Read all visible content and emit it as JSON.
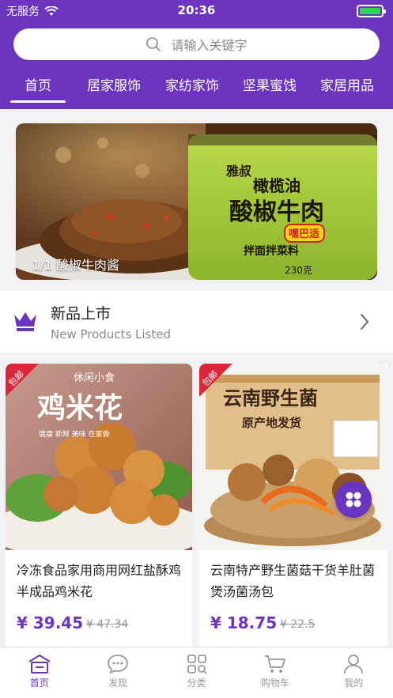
{
  "status_bar": {
    "carrier": "无服务",
    "time": "20:36"
  },
  "search": {
    "placeholder": "请输入关键字"
  },
  "tabs": [
    {
      "label": "首页",
      "active": true
    },
    {
      "label": "居家服饰"
    },
    {
      "label": "家纺家饰"
    },
    {
      "label": "坚果蜜饯"
    },
    {
      "label": "家居用品"
    }
  ],
  "banner": {
    "caption": "1/1 酸椒牛肉酱",
    "label_brand": "雅叔",
    "label_line1": "橄榄油",
    "label_line2": "酸椒牛肉",
    "label_badge": "嘿巴适",
    "label_line3": "拌面拌菜料",
    "label_weight": "230克"
  },
  "section": {
    "title": "新品上市",
    "subtitle": "New Products Listed"
  },
  "products": [
    {
      "name": "冷冻食品家用商用网红盐酥鸡半成品鸡米花",
      "price": "¥ 39.45",
      "old_price": "¥ 47.34",
      "ribbon": "包邮",
      "image_text_big": "鸡米花",
      "image_text_small": "休闲小食",
      "image_text_side": "健康 新鲜 美味 在家做"
    },
    {
      "name": "云南特产野生菌菇干货羊肚菌煲汤菌汤包",
      "price": "¥ 18.75",
      "old_price": "¥ 22.5",
      "ribbon": "包邮",
      "image_title": "云南野生菌",
      "image_subtitle": "原产地发货"
    }
  ],
  "bottom_nav": [
    {
      "label": "首页",
      "icon": "home-icon",
      "active": true
    },
    {
      "label": "发现",
      "icon": "chat-icon"
    },
    {
      "label": "分类",
      "icon": "category-icon"
    },
    {
      "label": "购物车",
      "icon": "cart-icon"
    },
    {
      "label": "我的",
      "icon": "user-icon"
    }
  ],
  "colors": {
    "brand": "#6b35bf",
    "battery": "#32d158"
  }
}
